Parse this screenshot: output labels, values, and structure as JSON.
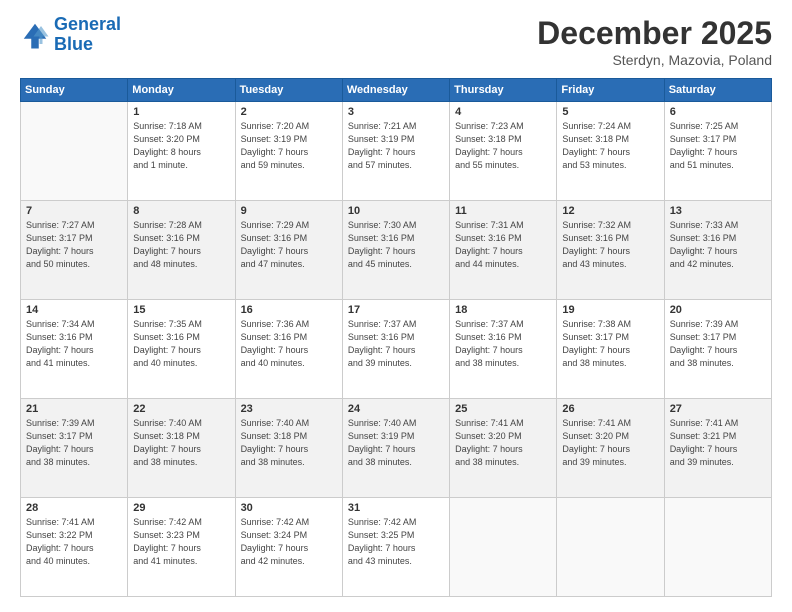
{
  "header": {
    "logo_line1": "General",
    "logo_line2": "Blue",
    "month": "December 2025",
    "location": "Sterdyn, Mazovia, Poland"
  },
  "weekdays": [
    "Sunday",
    "Monday",
    "Tuesday",
    "Wednesday",
    "Thursday",
    "Friday",
    "Saturday"
  ],
  "weeks": [
    [
      {
        "day": "",
        "info": ""
      },
      {
        "day": "1",
        "info": "Sunrise: 7:18 AM\nSunset: 3:20 PM\nDaylight: 8 hours\nand 1 minute."
      },
      {
        "day": "2",
        "info": "Sunrise: 7:20 AM\nSunset: 3:19 PM\nDaylight: 7 hours\nand 59 minutes."
      },
      {
        "day": "3",
        "info": "Sunrise: 7:21 AM\nSunset: 3:19 PM\nDaylight: 7 hours\nand 57 minutes."
      },
      {
        "day": "4",
        "info": "Sunrise: 7:23 AM\nSunset: 3:18 PM\nDaylight: 7 hours\nand 55 minutes."
      },
      {
        "day": "5",
        "info": "Sunrise: 7:24 AM\nSunset: 3:18 PM\nDaylight: 7 hours\nand 53 minutes."
      },
      {
        "day": "6",
        "info": "Sunrise: 7:25 AM\nSunset: 3:17 PM\nDaylight: 7 hours\nand 51 minutes."
      }
    ],
    [
      {
        "day": "7",
        "info": "Sunrise: 7:27 AM\nSunset: 3:17 PM\nDaylight: 7 hours\nand 50 minutes."
      },
      {
        "day": "8",
        "info": "Sunrise: 7:28 AM\nSunset: 3:16 PM\nDaylight: 7 hours\nand 48 minutes."
      },
      {
        "day": "9",
        "info": "Sunrise: 7:29 AM\nSunset: 3:16 PM\nDaylight: 7 hours\nand 47 minutes."
      },
      {
        "day": "10",
        "info": "Sunrise: 7:30 AM\nSunset: 3:16 PM\nDaylight: 7 hours\nand 45 minutes."
      },
      {
        "day": "11",
        "info": "Sunrise: 7:31 AM\nSunset: 3:16 PM\nDaylight: 7 hours\nand 44 minutes."
      },
      {
        "day": "12",
        "info": "Sunrise: 7:32 AM\nSunset: 3:16 PM\nDaylight: 7 hours\nand 43 minutes."
      },
      {
        "day": "13",
        "info": "Sunrise: 7:33 AM\nSunset: 3:16 PM\nDaylight: 7 hours\nand 42 minutes."
      }
    ],
    [
      {
        "day": "14",
        "info": "Sunrise: 7:34 AM\nSunset: 3:16 PM\nDaylight: 7 hours\nand 41 minutes."
      },
      {
        "day": "15",
        "info": "Sunrise: 7:35 AM\nSunset: 3:16 PM\nDaylight: 7 hours\nand 40 minutes."
      },
      {
        "day": "16",
        "info": "Sunrise: 7:36 AM\nSunset: 3:16 PM\nDaylight: 7 hours\nand 40 minutes."
      },
      {
        "day": "17",
        "info": "Sunrise: 7:37 AM\nSunset: 3:16 PM\nDaylight: 7 hours\nand 39 minutes."
      },
      {
        "day": "18",
        "info": "Sunrise: 7:37 AM\nSunset: 3:16 PM\nDaylight: 7 hours\nand 38 minutes."
      },
      {
        "day": "19",
        "info": "Sunrise: 7:38 AM\nSunset: 3:17 PM\nDaylight: 7 hours\nand 38 minutes."
      },
      {
        "day": "20",
        "info": "Sunrise: 7:39 AM\nSunset: 3:17 PM\nDaylight: 7 hours\nand 38 minutes."
      }
    ],
    [
      {
        "day": "21",
        "info": "Sunrise: 7:39 AM\nSunset: 3:17 PM\nDaylight: 7 hours\nand 38 minutes."
      },
      {
        "day": "22",
        "info": "Sunrise: 7:40 AM\nSunset: 3:18 PM\nDaylight: 7 hours\nand 38 minutes."
      },
      {
        "day": "23",
        "info": "Sunrise: 7:40 AM\nSunset: 3:18 PM\nDaylight: 7 hours\nand 38 minutes."
      },
      {
        "day": "24",
        "info": "Sunrise: 7:40 AM\nSunset: 3:19 PM\nDaylight: 7 hours\nand 38 minutes."
      },
      {
        "day": "25",
        "info": "Sunrise: 7:41 AM\nSunset: 3:20 PM\nDaylight: 7 hours\nand 38 minutes."
      },
      {
        "day": "26",
        "info": "Sunrise: 7:41 AM\nSunset: 3:20 PM\nDaylight: 7 hours\nand 39 minutes."
      },
      {
        "day": "27",
        "info": "Sunrise: 7:41 AM\nSunset: 3:21 PM\nDaylight: 7 hours\nand 39 minutes."
      }
    ],
    [
      {
        "day": "28",
        "info": "Sunrise: 7:41 AM\nSunset: 3:22 PM\nDaylight: 7 hours\nand 40 minutes."
      },
      {
        "day": "29",
        "info": "Sunrise: 7:42 AM\nSunset: 3:23 PM\nDaylight: 7 hours\nand 41 minutes."
      },
      {
        "day": "30",
        "info": "Sunrise: 7:42 AM\nSunset: 3:24 PM\nDaylight: 7 hours\nand 42 minutes."
      },
      {
        "day": "31",
        "info": "Sunrise: 7:42 AM\nSunset: 3:25 PM\nDaylight: 7 hours\nand 43 minutes."
      },
      {
        "day": "",
        "info": ""
      },
      {
        "day": "",
        "info": ""
      },
      {
        "day": "",
        "info": ""
      }
    ]
  ]
}
